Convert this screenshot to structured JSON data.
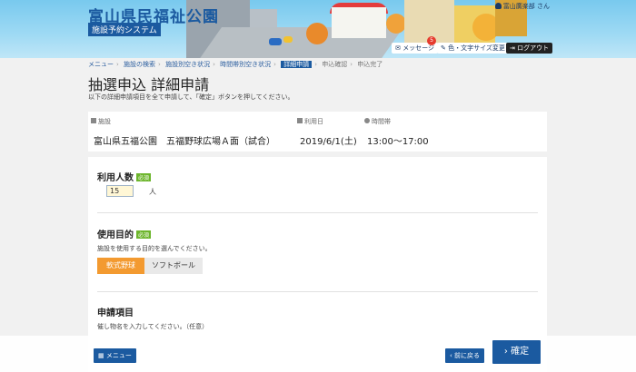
{
  "header": {
    "site_title": "富山県民福祉公園",
    "system_tag": "施設予約システム",
    "user": "富山廣楽部 さん",
    "message_label": "メッセージ",
    "message_badge": "5",
    "font_label": "色・文字サイズ変更",
    "logout_label": "ログアウト"
  },
  "breadcrumb": [
    "メニュー",
    "施設の検索",
    "施設別空き状況",
    "時間帯別空き状況",
    "詳細申請",
    "申込確認",
    "申込完了"
  ],
  "page": {
    "title": "抽選申込 詳細申請",
    "description": "以下の詳細申請項目を全て申請して、「確定」ボタンを押してください。"
  },
  "facility": {
    "facility_label": "施設",
    "facility_value": "富山県五福公園　五福野球広場Ａ面（試合）",
    "date_label": "利用日",
    "date_value": "2019/6/1(土)",
    "time_label": "時間帯",
    "time_value": "13:00～17:00"
  },
  "form": {
    "people": {
      "title": "利用人数",
      "required": "必須",
      "value": "15",
      "unit": "人"
    },
    "purpose": {
      "title": "使用目的",
      "required": "必須",
      "description": "施設を使用する目的を選んでください。",
      "options": [
        "軟式野球",
        "ソフトボール"
      ],
      "selected": "軟式野球"
    },
    "items": {
      "title": "申請項目",
      "description": "催し物名を入力してください。（任意）"
    }
  },
  "footer": {
    "menu_label": "メニュー",
    "back_label": "前に戻る",
    "confirm_label": "確定"
  },
  "colors": {
    "primary": "#1b5aa0",
    "accent": "#f39a30",
    "required": "#6cb52b"
  }
}
